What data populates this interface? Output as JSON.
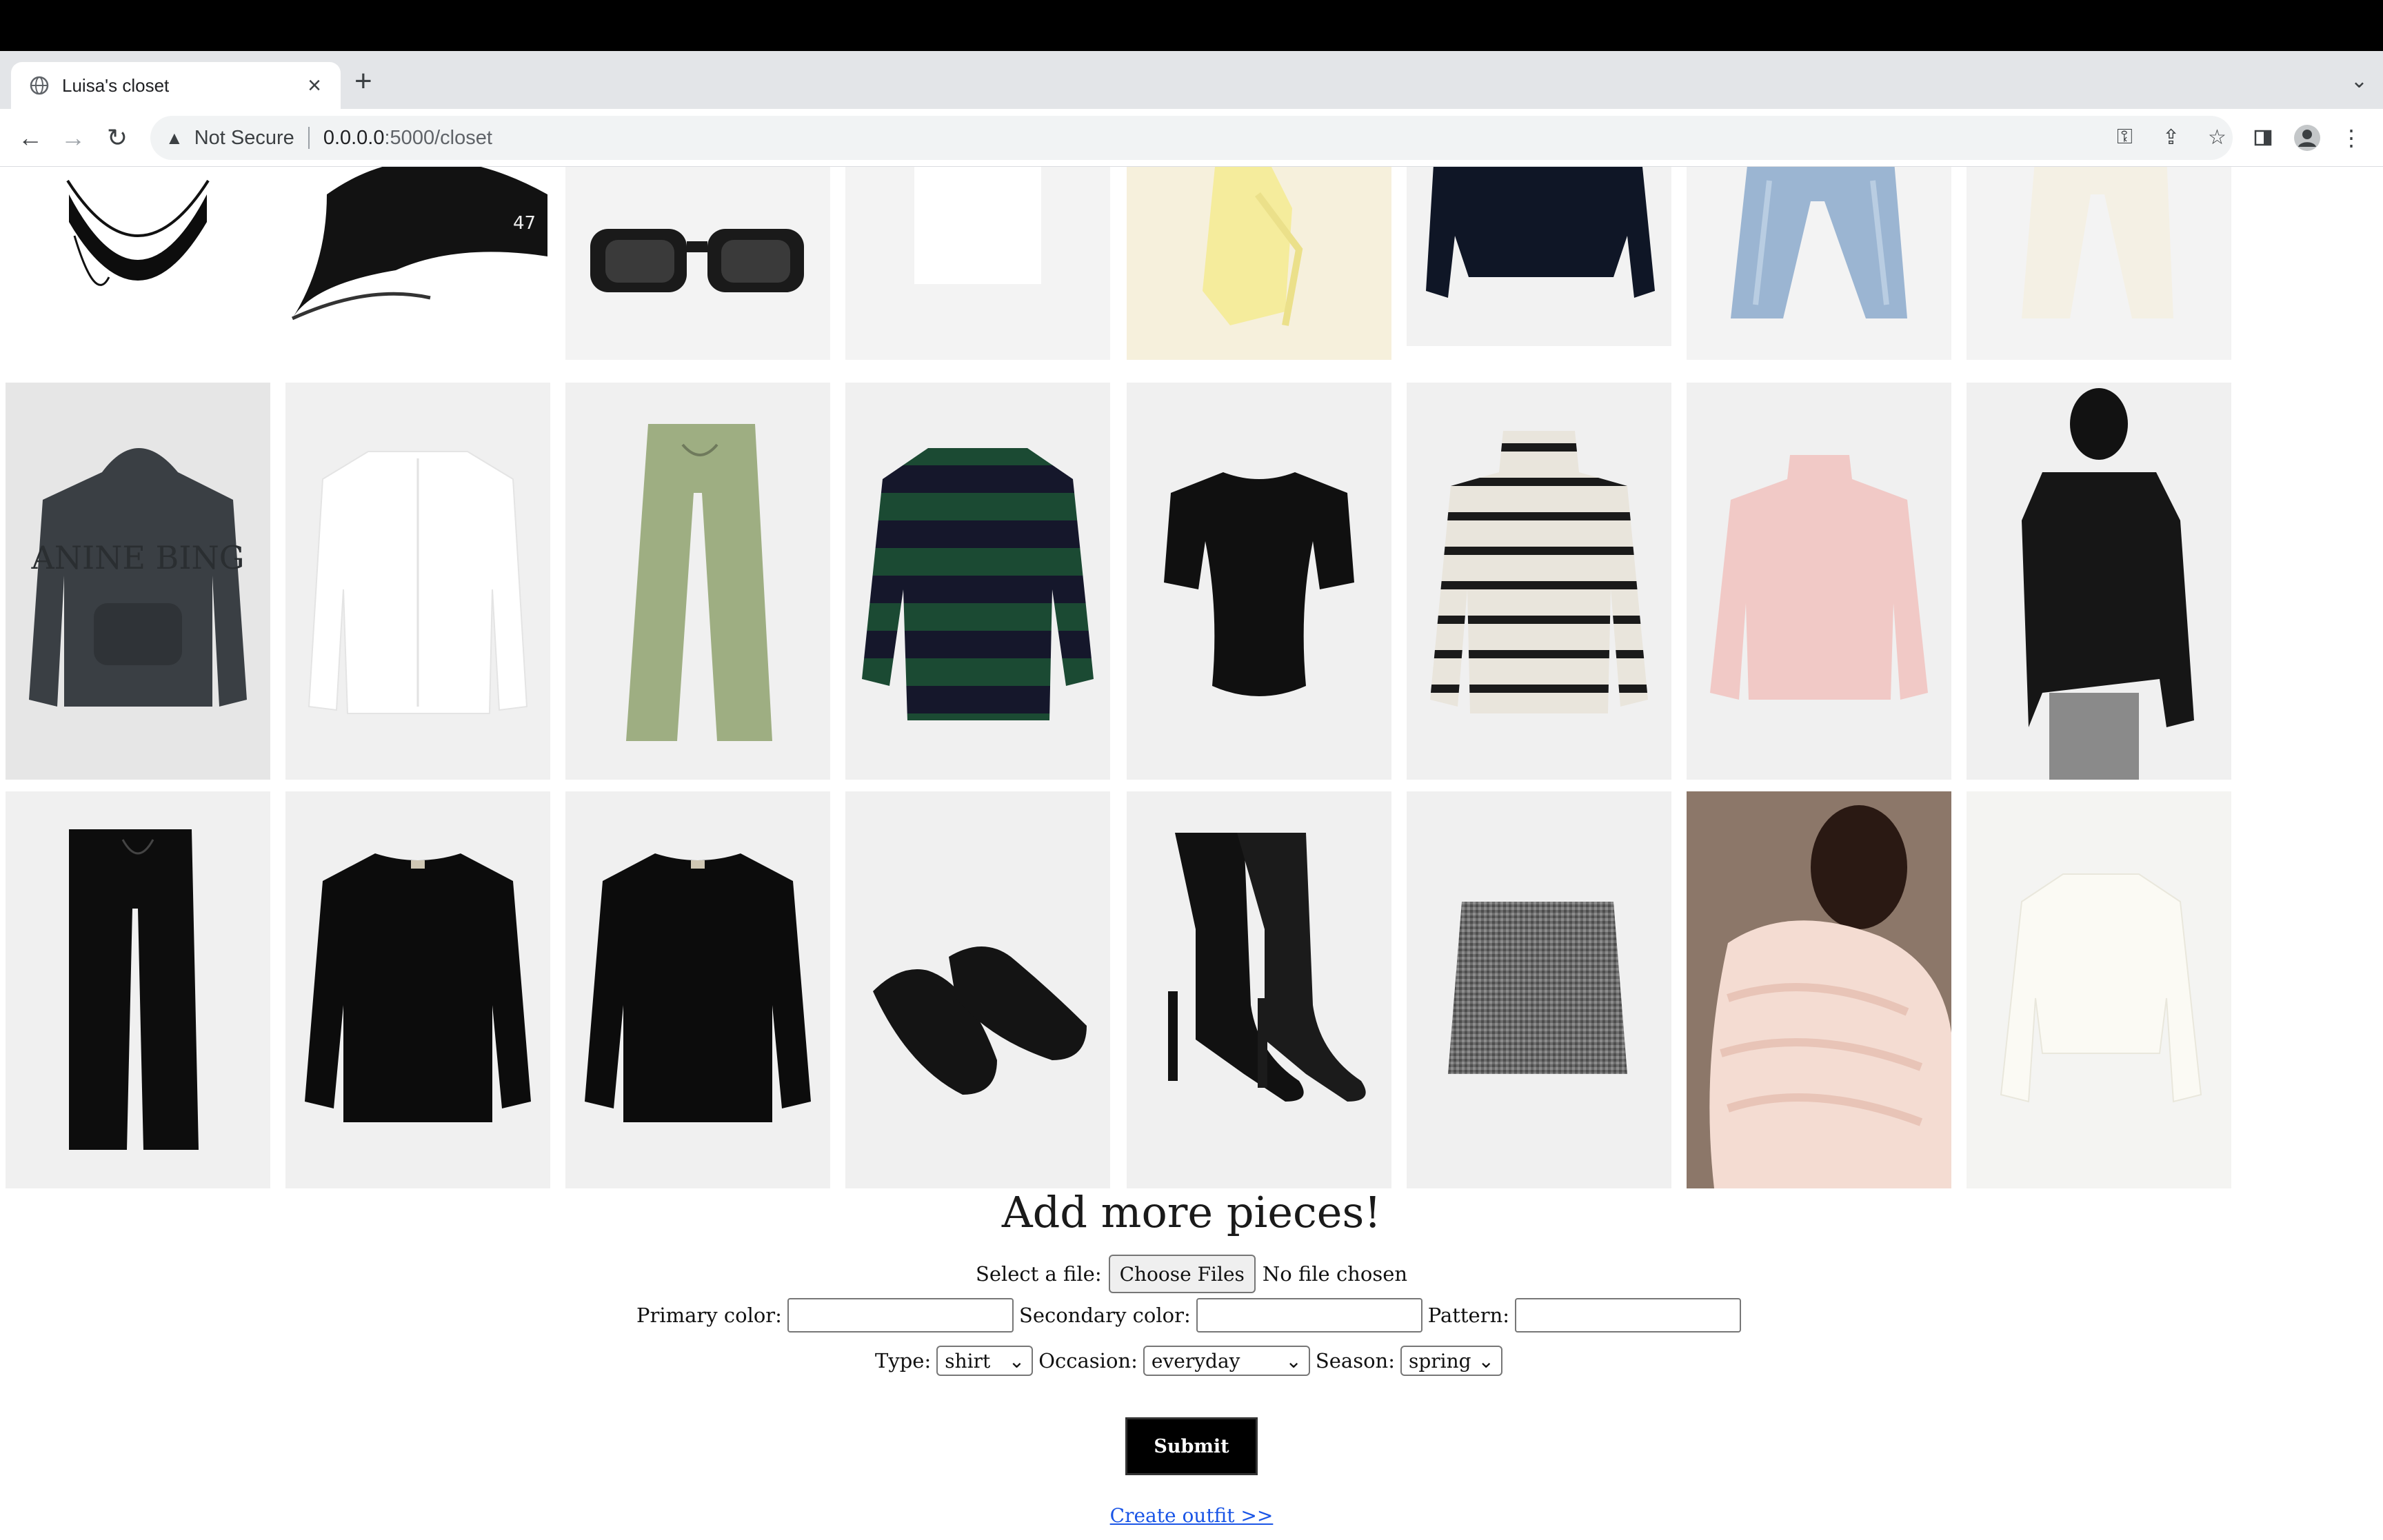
{
  "browser": {
    "tab_title": "Luisa's closet",
    "close_glyph": "×",
    "new_tab_glyph": "+",
    "security_label": "Not Secure",
    "url_host": "0.0.0.0",
    "url_path": ":5000/closet"
  },
  "closet": {
    "items": [
      {
        "name": "black-half-moon-bag"
      },
      {
        "name": "black-baseball-cap"
      },
      {
        "name": "black-sunglasses"
      },
      {
        "name": "white-top"
      },
      {
        "name": "yellow-ruffle-dress"
      },
      {
        "name": "navy-sweater"
      },
      {
        "name": "light-wash-jeans"
      },
      {
        "name": "cream-trousers"
      },
      {
        "name": "charcoal-hoodie"
      },
      {
        "name": "white-shirt"
      },
      {
        "name": "sage-linen-pants"
      },
      {
        "name": "green-navy-striped-sweater"
      },
      {
        "name": "black-fitted-tee"
      },
      {
        "name": "cream-black-striped-turtleneck"
      },
      {
        "name": "pink-mock-neck-sweater"
      },
      {
        "name": "black-leather-jacket"
      },
      {
        "name": "black-knit-pants"
      },
      {
        "name": "black-oversized-sweater"
      },
      {
        "name": "black-oversized-sweater-2"
      },
      {
        "name": "black-ballet-flats"
      },
      {
        "name": "black-heeled-boots"
      },
      {
        "name": "grey-tweed-mini-skirt"
      },
      {
        "name": "blush-ruffle-blouse"
      },
      {
        "name": "ivory-satin-blouse"
      }
    ]
  },
  "form": {
    "heading": "Add more pieces!",
    "file_label": "Select a file:",
    "file_button": "Choose Files",
    "file_status": "No file chosen",
    "primary_color_label": "Primary color:",
    "primary_color_value": "",
    "secondary_color_label": "Secondary color:",
    "secondary_color_value": "",
    "pattern_label": "Pattern:",
    "pattern_value": "",
    "type_label": "Type:",
    "type_value": "shirt",
    "occasion_label": "Occasion:",
    "occasion_value": "everyday",
    "season_label": "Season:",
    "season_value": "spring",
    "submit_label": "Submit",
    "create_outfit_link": "Create outfit >>"
  }
}
